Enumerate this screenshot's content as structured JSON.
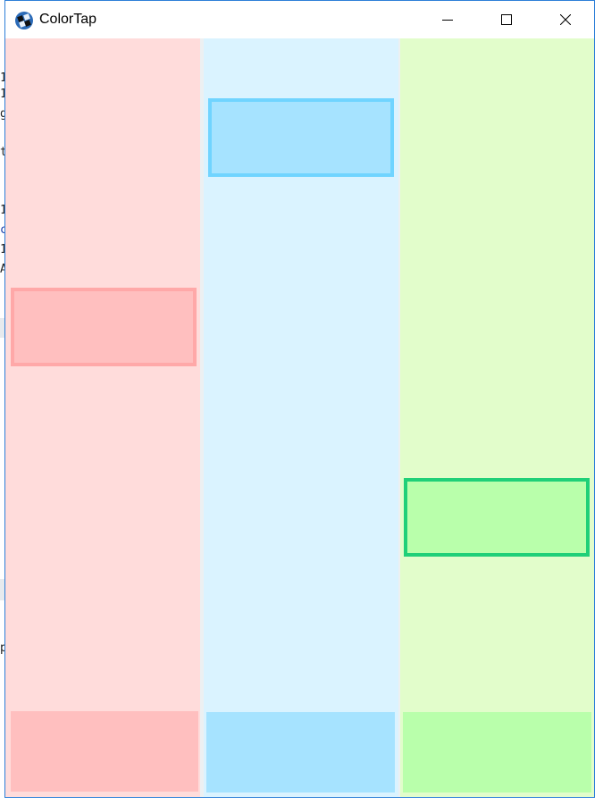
{
  "window": {
    "title": "ColorTap",
    "controls": {
      "minimize": "minimize",
      "maximize": "maximize",
      "close": "close"
    }
  },
  "background_glyphs": [
    "1",
    "1",
    "g",
    "t",
    "1",
    "c",
    "1",
    "A",
    "p"
  ],
  "lanes": [
    {
      "id": "red",
      "lane_color": "#ffdcdb",
      "note_fill": "#ffbfbf",
      "note_border": "#ffa8a8",
      "pad_color": "#ffbfbf",
      "note_progress": 0.42
    },
    {
      "id": "blue",
      "lane_color": "#daf3ff",
      "note_fill": "#a6e3ff",
      "note_border": "#70d4ff",
      "pad_color": "#a6e3ff",
      "note_progress": 0.1
    },
    {
      "id": "green",
      "lane_color": "#e2fdcb",
      "note_fill": "#b9ffab",
      "note_border": "#1fd078",
      "pad_color": "#b9ffab",
      "note_progress": 0.74
    }
  ]
}
